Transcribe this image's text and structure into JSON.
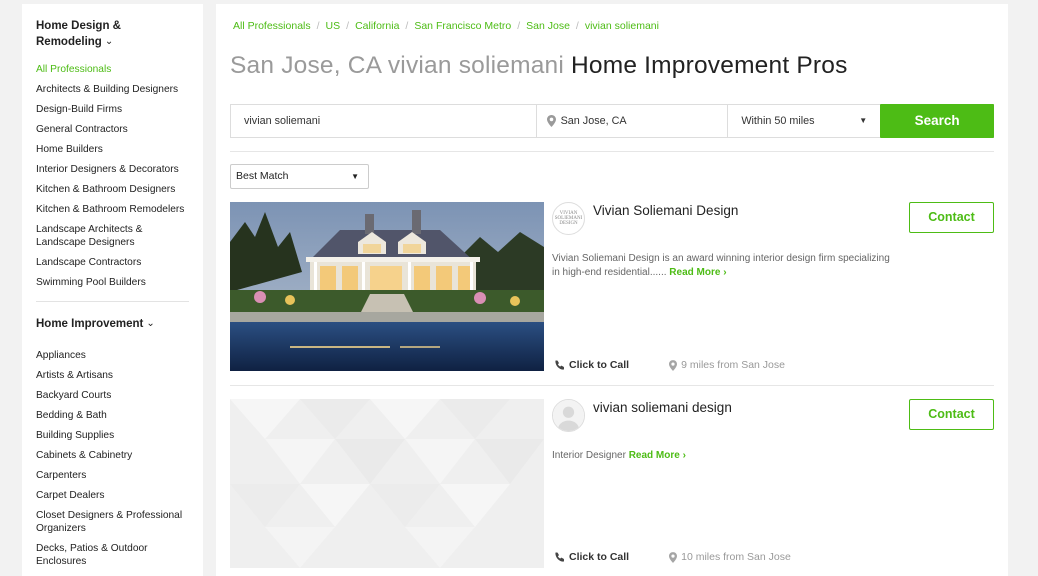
{
  "sidebar": {
    "section1": {
      "title_line1": "Home Design &",
      "title_line2": "Remodeling",
      "items": [
        "All Professionals",
        "Architects & Building Designers",
        "Design-Build Firms",
        "General Contractors",
        "Home Builders",
        "Interior Designers & Decorators",
        "Kitchen & Bathroom Designers",
        "Kitchen & Bathroom Remodelers",
        "Landscape Architects & Landscape Designers",
        "Landscape Contractors",
        "Swimming Pool Builders"
      ]
    },
    "section2": {
      "title": "Home Improvement",
      "items": [
        "Appliances",
        "Artists & Artisans",
        "Backyard Courts",
        "Bedding & Bath",
        "Building Supplies",
        "Cabinets & Cabinetry",
        "Carpenters",
        "Carpet Dealers",
        "Closet Designers & Professional Organizers",
        "Decks, Patios & Outdoor Enclosures"
      ]
    }
  },
  "breadcrumb": [
    "All Professionals",
    "US",
    "California",
    "San Francisco Metro",
    "San Jose",
    "vivian soliemani"
  ],
  "title": {
    "light": "San Jose, CA vivian soliemani",
    "dark": "Home Improvement Pros"
  },
  "search": {
    "keyword": "vivian soliemani",
    "location": "San Jose, CA",
    "radius": "Within 50 miles",
    "button": "Search"
  },
  "sort": {
    "selected": "Best Match"
  },
  "results": [
    {
      "name": "Vivian Soliemani Design",
      "logo_text": "VIVIAN SOLIEMANI DESIGN",
      "description": "Vivian Soliemani Design is an award winning interior design firm specializing in high-end residential......",
      "read_more": "Read More ›",
      "contact": "Contact",
      "call": "Click to Call",
      "distance": "9 miles from San Jose"
    },
    {
      "name": "vivian soliemani design",
      "description": "Interior Designer",
      "read_more": "Read More ›",
      "contact": "Contact",
      "call": "Click to Call",
      "distance": "10 miles from San Jose"
    }
  ],
  "colors": {
    "accent": "#4dbc15",
    "muted": "#9a9a9a"
  }
}
